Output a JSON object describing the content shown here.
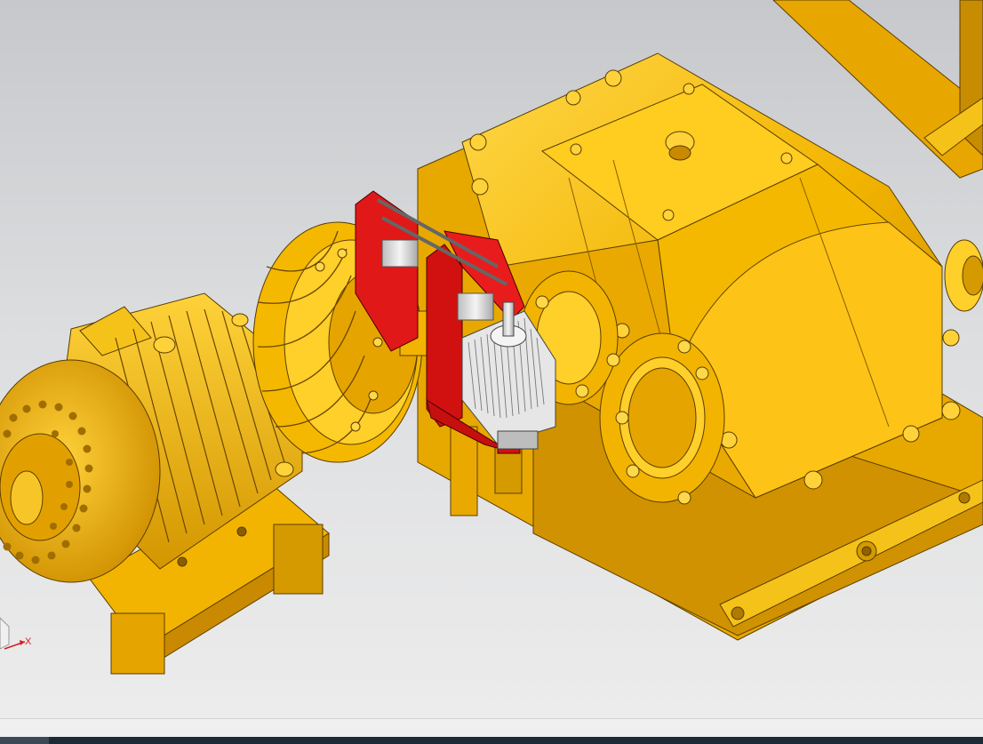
{
  "viewport": {
    "description_free": true,
    "triad": {
      "x_label": "X"
    }
  },
  "colors": {
    "part_yellow": "#f2b400",
    "part_yellow_light": "#ffd23a",
    "part_yellow_dark": "#b97f00",
    "brake_red": "#e01818",
    "thruster_grey": "#e4e4e4",
    "background_top": "#c6c8cb",
    "background_bottom": "#ececec",
    "taskbar": "#1c2b36"
  },
  "icons": [
    "view-triad-icon"
  ]
}
